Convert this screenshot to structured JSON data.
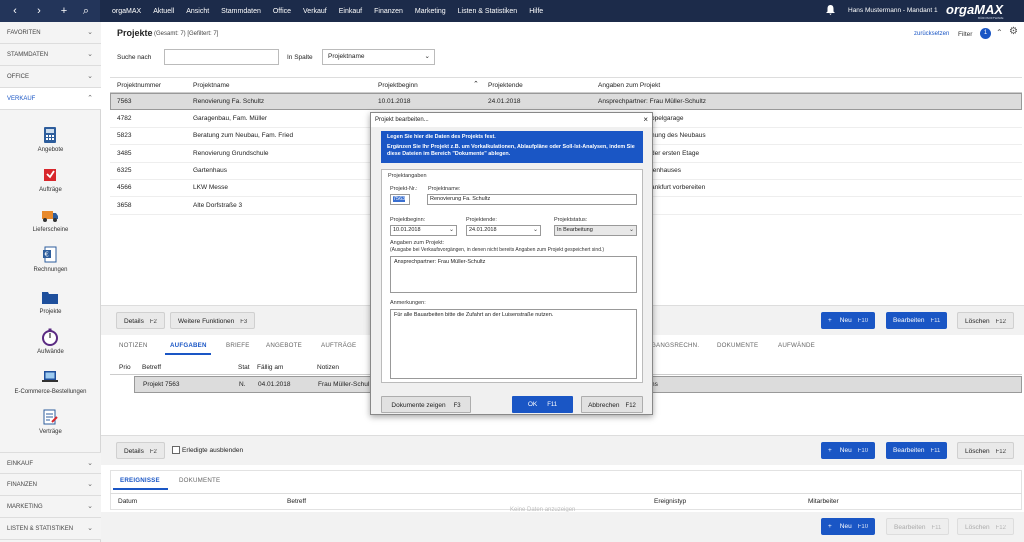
{
  "topbar": {
    "app": "orgaMAX",
    "menu": [
      "Aktuell",
      "Ansicht",
      "Stammdaten",
      "Office",
      "Verkauf",
      "Einkauf",
      "Finanzen",
      "Marketing",
      "Listen & Statistiken",
      "Hilfe"
    ],
    "user": "Hans Mustermann - Mandant 1",
    "logo": "orgaMAX",
    "logo_sub": "BÜROSOFTWARE"
  },
  "sidebar": {
    "top_sections": [
      "FAVORITEN",
      "STAMMDATEN",
      "OFFICE",
      "VERKAUF"
    ],
    "items": [
      "Angebote",
      "Aufträge",
      "Lieferscheine",
      "Rechnungen",
      "Projekte",
      "Aufwände",
      "E-Commerce-Bestellungen",
      "Verträge"
    ],
    "bottom_sections": [
      "EINKAUF",
      "FINANZEN",
      "MARKETING",
      "LISTEN & STATISTIKEN"
    ]
  },
  "header": {
    "title": "Projekte",
    "counts": "(Gesamt: 7) [Gefiltert: 7]",
    "reset": "zurücksetzen",
    "filter": "Filter",
    "filter_count": "1"
  },
  "search": {
    "label": "Suche nach",
    "column_label": "In Spalte",
    "column_value": "Projektname"
  },
  "projects": {
    "columns": [
      "Projektnummer",
      "Projektname",
      "Projektbeginn",
      "Projektende",
      "Angaben zum Projekt"
    ],
    "rows": [
      [
        "7563",
        "Renovierung Fa. Schultz",
        "10.01.2018",
        "24.01.2018",
        "Ansprechpartner: Frau Müller-Schultz"
      ],
      [
        "4782",
        "Garagenbau, Fam. Müller",
        "",
        "",
        "ppelgarage"
      ],
      [
        "5823",
        "Beratung zum Neubau, Fam. Fried",
        "",
        "",
        "nung des Neubaus"
      ],
      [
        "3485",
        "Renovierung Grundschule",
        "",
        "",
        "der ersten Etage"
      ],
      [
        "6325",
        "Gartenhaus",
        "",
        "",
        "tenhauses"
      ],
      [
        "4566",
        "LKW Messe",
        "",
        "",
        "ankfurt vorbereiten"
      ],
      [
        "3658",
        "Alte Dorfstraße 3",
        "",
        "",
        ""
      ]
    ]
  },
  "buttons": {
    "details": "Details",
    "details_key": "F2",
    "more": "Weitere Funktionen",
    "more_key": "F3",
    "new": "Neu",
    "new_key": "F10",
    "edit": "Bearbeiten",
    "edit_key": "F11",
    "delete": "Löschen",
    "delete_key": "F12"
  },
  "tabs1": [
    "NOTIZEN",
    "AUFGABEN",
    "BRIEFE",
    "ANGEBOTE",
    "AUFTRÄGE",
    "GANGSRECHN.",
    "DOKUMENTE",
    "AUFWÄNDE"
  ],
  "tasks": {
    "columns": [
      "Prio",
      "Betreff",
      "Stat",
      "Fällig am",
      "Notizen"
    ],
    "row": [
      "",
      "Projekt 7563",
      "N.",
      "04.01.2018",
      "Frau Müller-Schul",
      "ns"
    ]
  },
  "hide_done": "Erledigte ausblenden",
  "tabs2": [
    "EREIGNISSE",
    "DOKUMENTE"
  ],
  "events": {
    "columns": [
      "Datum",
      "Betreff",
      "Ereignistyp",
      "Mitarbeiter"
    ],
    "empty": "Keine Daten anzuzeigen"
  },
  "dialog": {
    "title": "Projekt bearbeiten...",
    "info1": "Legen Sie hier die Daten des Projekts fest.",
    "info2": "Ergänzen Sie Ihr Projekt z.B. um Vorkalkulationen, Ablaufpläne oder Soll-Ist-Analysen, indem Sie diese Dateien im Bereich \"Dokumente\" ablegen.",
    "group": "Projektangaben",
    "nr_label": "Projekt-Nr.:",
    "nr": "7563",
    "name_label": "Projektname:",
    "name": "Renovierung Fa. Schultz",
    "begin_label": "Projektbeginn:",
    "begin": "10.01.2018",
    "end_label": "Projektende:",
    "end": "24.01.2018",
    "status_label": "Projektstatus:",
    "status": "In Bearbeitung",
    "info_label": "Angaben zum Projekt:",
    "info_hint": "(Ausgabe bei Verkaufsvorgängen, in denen nicht bereits Angaben zum Projekt gespeichert sind.)",
    "info_value": "Ansprechpartner: Frau Müller-Schultz",
    "notes_label": "Anmerkungen:",
    "notes_value": "Für alle Bauarbeiten bitte die Zufahrt an der Luisenstraße nutzen.",
    "docs": "Dokumente zeigen",
    "docs_key": "F3",
    "ok": "OK",
    "ok_key": "F11",
    "cancel": "Abbrechen",
    "cancel_key": "F12"
  }
}
